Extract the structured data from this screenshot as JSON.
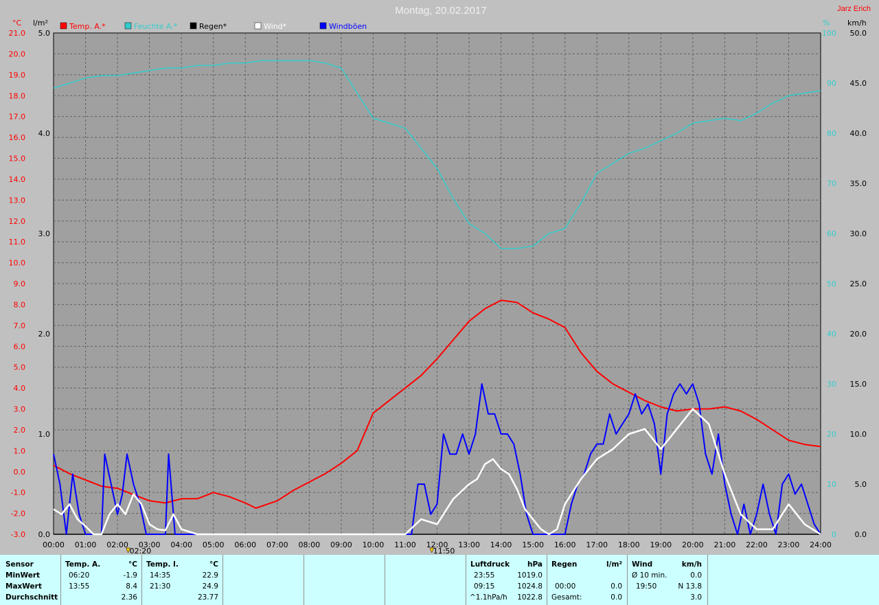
{
  "title": "Montag, 20.02.2017",
  "author": "Jarz Erich",
  "axes": {
    "left1_unit": "°C",
    "left2_unit": "l/m²",
    "right1_unit": "%",
    "right2_unit": "km/h",
    "temp_ticks": [
      "21.0",
      "20.0",
      "19.0",
      "18.0",
      "17.0",
      "16.0",
      "15.0",
      "14.0",
      "13.0",
      "12.0",
      "11.0",
      "10.0",
      "9.0",
      "8.0",
      "7.0",
      "6.0",
      "5.0",
      "4.0",
      "3.0",
      "2.0",
      "1.0",
      "0.0",
      "-1.0",
      "-2.0",
      "-3.0"
    ],
    "rain_ticks": [
      "5.0",
      "4.0",
      "3.0",
      "2.0",
      "1.0",
      "0.0"
    ],
    "hum_ticks": [
      "100",
      "90",
      "80",
      "70",
      "60",
      "50",
      "40",
      "30",
      "20",
      "10",
      "0"
    ],
    "wind_ticks": [
      "50.0",
      "45.0",
      "40.0",
      "35.0",
      "30.0",
      "25.0",
      "20.0",
      "15.0",
      "10.0",
      "5.0",
      "0.0"
    ],
    "time_ticks": [
      "00:00",
      "01:00",
      "02:00",
      "03:00",
      "04:00",
      "05:00",
      "06:00",
      "07:00",
      "08:00",
      "09:00",
      "10:00",
      "11:00",
      "12:00",
      "13:00",
      "14:00",
      "15:00",
      "16:00",
      "17:00",
      "18:00",
      "19:00",
      "20:00",
      "21:00",
      "22:00",
      "23:00",
      "24:00"
    ]
  },
  "markers": [
    {
      "label": "02:20",
      "t": 2.333
    },
    {
      "label": "11:50",
      "t": 11.833
    }
  ],
  "colors": {
    "temp": "#ff0000",
    "humidity": "#33cccc",
    "rain": "#000000",
    "wind": "#ffffff",
    "gust": "#0000ff",
    "plot_bg": "#a0a0a0",
    "page_bg": "#c0c0c0",
    "panel_bg": "#ccffff"
  },
  "chart_data": {
    "type": "line",
    "title": "Montag, 20.02.2017",
    "x_unit": "hour of day",
    "xlim": [
      0,
      24
    ],
    "series": [
      {
        "name": "Temp. A.*",
        "unit": "°C",
        "ylim": [
          -3,
          21
        ],
        "axis": "left",
        "x": [
          0,
          0.5,
          1,
          1.5,
          2,
          2.5,
          3,
          3.5,
          4,
          4.5,
          5,
          5.5,
          6,
          6.33,
          7,
          7.5,
          8,
          8.5,
          9,
          9.5,
          10,
          10.5,
          11,
          11.5,
          12,
          12.5,
          13,
          13.5,
          14,
          14.5,
          15,
          15.5,
          16,
          16.5,
          17,
          17.5,
          18,
          18.5,
          19,
          19.5,
          20,
          20.5,
          21,
          21.5,
          22,
          22.5,
          23,
          23.5,
          24
        ],
        "y": [
          0.3,
          -0.1,
          -0.4,
          -0.7,
          -0.8,
          -1.1,
          -1.4,
          -1.5,
          -1.3,
          -1.3,
          -1.0,
          -1.2,
          -1.5,
          -1.75,
          -1.4,
          -0.9,
          -0.5,
          -0.1,
          0.4,
          1.0,
          2.8,
          3.4,
          4.0,
          4.6,
          5.4,
          6.3,
          7.2,
          7.8,
          8.2,
          8.1,
          7.6,
          7.3,
          6.9,
          5.7,
          4.8,
          4.2,
          3.8,
          3.4,
          3.1,
          2.9,
          3.0,
          3.0,
          3.1,
          2.9,
          2.5,
          2.0,
          1.5,
          1.3,
          1.2
        ]
      },
      {
        "name": "Feuchte A.*",
        "unit": "%",
        "ylim": [
          0,
          100
        ],
        "axis": "right",
        "x": [
          0,
          0.5,
          1,
          1.5,
          2,
          2.5,
          3,
          3.5,
          4,
          4.5,
          5,
          5.5,
          6,
          6.5,
          7,
          7.5,
          8,
          8.5,
          9,
          9.5,
          10,
          10.5,
          11,
          11.5,
          12,
          12.5,
          13,
          13.5,
          14,
          14.5,
          15,
          15.5,
          16,
          16.5,
          17,
          17.5,
          18,
          18.5,
          19,
          19.5,
          20,
          20.5,
          21,
          21.5,
          22,
          22.5,
          23,
          23.5,
          24
        ],
        "y": [
          89,
          90,
          91,
          91.5,
          91.5,
          92,
          92.5,
          93,
          93,
          93.5,
          93.5,
          94,
          94,
          94.5,
          94.5,
          94.5,
          94.5,
          94,
          93,
          88,
          83,
          82,
          81,
          77,
          73,
          67,
          62,
          60,
          57,
          57,
          57.5,
          60,
          61,
          66,
          72,
          74,
          76,
          77,
          78.5,
          80,
          82,
          82.5,
          83,
          82.5,
          84,
          86,
          87.5,
          88,
          88.5
        ]
      },
      {
        "name": "Regen*",
        "unit": "l/m²",
        "ylim": [
          0,
          5
        ],
        "axis": "left",
        "x": [
          0,
          24
        ],
        "y": [
          0,
          0
        ]
      },
      {
        "name": "Wind*",
        "unit": "km/h",
        "ylim": [
          0,
          50
        ],
        "axis": "right",
        "x": [
          0,
          0.25,
          0.5,
          0.75,
          1,
          1.25,
          1.5,
          1.75,
          2,
          2.25,
          2.5,
          2.75,
          3,
          3.25,
          3.5,
          3.75,
          4,
          4.5,
          5,
          11,
          11.5,
          12,
          12.5,
          13,
          13.25,
          13.5,
          13.75,
          14,
          14.25,
          14.5,
          14.75,
          15,
          15.25,
          15.5,
          15.75,
          16,
          16.5,
          17,
          17.5,
          18,
          18.5,
          19,
          19.5,
          20,
          20.5,
          21,
          21.5,
          22,
          22.5,
          23,
          23.5,
          24
        ],
        "y": [
          2.5,
          2,
          3,
          1.5,
          0.8,
          0,
          0,
          2,
          3,
          2,
          4,
          3,
          1,
          0.5,
          0.4,
          2,
          0.5,
          0,
          0,
          0,
          1.5,
          1,
          3.5,
          5,
          5.5,
          7,
          7.5,
          6.5,
          6,
          4.5,
          2.5,
          1.5,
          0.5,
          0,
          0.5,
          3,
          5.5,
          7.5,
          8.5,
          10,
          10.5,
          8.5,
          10.5,
          12.5,
          11,
          6,
          2,
          0.5,
          0.5,
          3,
          1,
          0
        ]
      },
      {
        "name": "Windböen",
        "unit": "km/h",
        "ylim": [
          0,
          50
        ],
        "axis": "right",
        "x": [
          0,
          0.2,
          0.4,
          0.6,
          0.8,
          1,
          1.3,
          1.5,
          1.6,
          1.8,
          2,
          2.15,
          2.3,
          2.5,
          2.7,
          2.9,
          3,
          3.2,
          3.5,
          3.6,
          3.8,
          11.2,
          11.4,
          11.6,
          11.8,
          12,
          12.2,
          12.4,
          12.6,
          12.8,
          13,
          13.2,
          13.4,
          13.6,
          13.8,
          14,
          14.2,
          14.4,
          14.6,
          14.8,
          15,
          15.2,
          15.4,
          15.6,
          15.8,
          16,
          16.2,
          16.4,
          16.6,
          16.8,
          17,
          17.2,
          17.4,
          17.6,
          17.8,
          18,
          18.2,
          18.4,
          18.6,
          18.8,
          19,
          19.2,
          19.4,
          19.6,
          19.8,
          20,
          20.2,
          20.4,
          20.6,
          20.8,
          21,
          21.2,
          21.4,
          21.6,
          21.8,
          22,
          22.2,
          22.4,
          22.6,
          22.8,
          23,
          23.2,
          23.4,
          23.6,
          23.8,
          24
        ],
        "y": [
          8,
          5,
          0,
          6,
          2,
          0,
          0,
          0,
          8,
          5,
          2,
          4,
          8,
          5,
          3,
          0,
          0,
          0,
          0,
          8,
          0,
          0,
          5,
          5,
          2,
          3,
          10,
          8,
          8,
          10,
          8,
          10,
          15,
          12,
          12,
          10,
          10,
          9,
          6,
          2,
          0,
          0,
          0,
          0,
          0,
          0,
          3,
          5,
          6,
          8,
          9,
          9,
          12,
          10,
          11,
          12,
          14,
          12,
          13,
          11,
          6,
          12,
          14,
          15,
          14,
          15,
          13,
          8,
          6,
          10,
          5,
          2,
          0,
          3,
          0,
          2,
          5,
          2,
          0,
          5,
          6,
          4,
          5,
          3,
          1,
          0
        ]
      }
    ]
  },
  "table": {
    "row_labels": [
      "Sensor",
      "MinWert",
      "MaxWert",
      "Durchschnitt"
    ],
    "temp_a": {
      "header": "Temp. A.",
      "unit": "°C",
      "min_time": "06:20",
      "min_val": "-1.9",
      "max_time": "13:55",
      "max_val": "8.4",
      "avg": "2.36"
    },
    "temp_i": {
      "header": "Temp. I.",
      "unit": "°C",
      "min_time": "14:35",
      "min_val": "22.9",
      "max_time": "21:30",
      "max_val": "24.9",
      "avg": "23.77"
    },
    "pressure": {
      "header": "Luftdruck",
      "unit": "hPa",
      "r1_time": "23:55",
      "r1_val": "1019.0",
      "r2_time": "09:15",
      "r2_val": "1024.8",
      "r3_time": "^1.1hPa/h",
      "r3_val": "1022.8"
    },
    "rain": {
      "header": "Regen",
      "unit": "l/m²",
      "r2_time": "00:00",
      "r2_val": "0.0",
      "r3_label": "Gesamt:",
      "r3_val": "0.0"
    },
    "wind": {
      "header": "Wind",
      "unit": "km/h",
      "r1_label": "Ø 10 min.",
      "r1_val": "0.0",
      "r2_time": "19:50",
      "r2_val": "N 13.8",
      "r3_val": "3.0"
    }
  }
}
